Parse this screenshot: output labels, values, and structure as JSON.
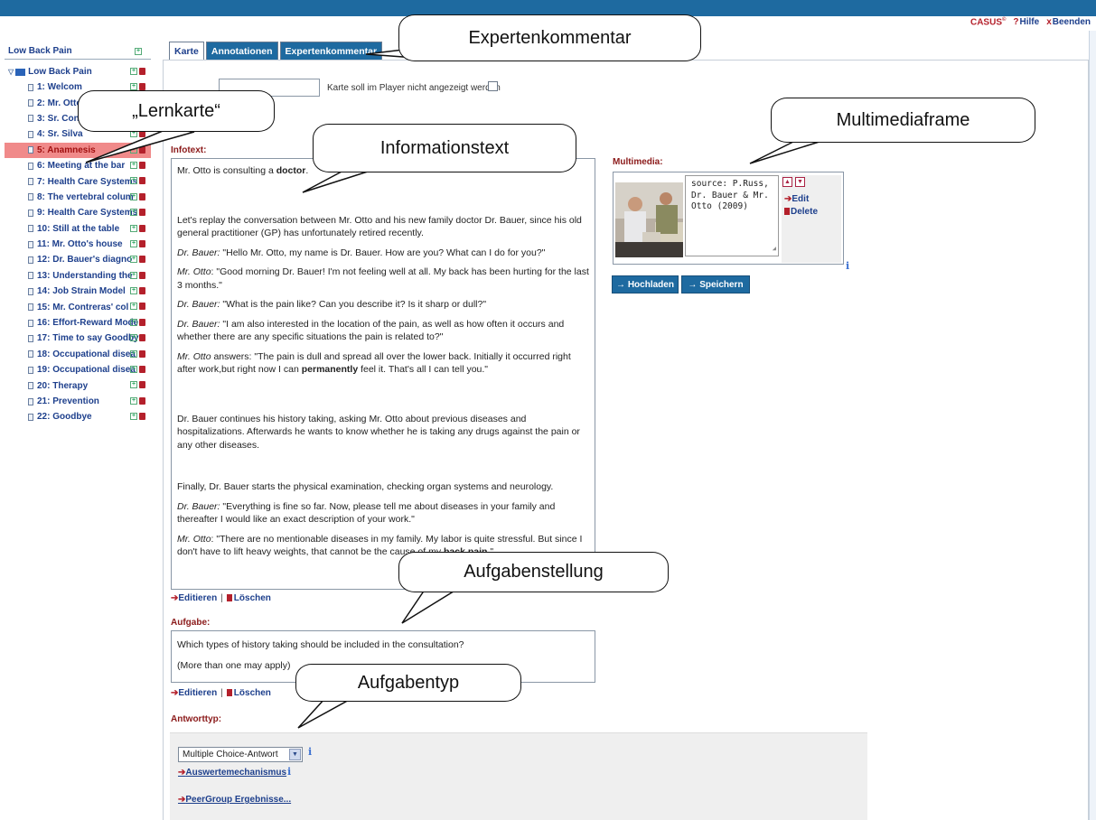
{
  "header": {
    "brand": "CASUS",
    "brand_mark": "©",
    "help_label": "Hilfe",
    "help_mark": "?",
    "exit_label": "Beenden",
    "exit_mark": "x"
  },
  "sidebar": {
    "title": "Low Back Pain",
    "root_label": "Low Back Pain",
    "items": [
      {
        "label": "1: Welcom"
      },
      {
        "label": "2: Mr. Otto"
      },
      {
        "label": "3: Sr. Cont"
      },
      {
        "label": "4: Sr. Silva"
      },
      {
        "label": "5: Anamnesis",
        "active": true
      },
      {
        "label": "6: Meeting at the bar"
      },
      {
        "label": "7: Health Care Systems"
      },
      {
        "label": "8: The vertebral colum"
      },
      {
        "label": "9: Health Care Systems"
      },
      {
        "label": "10: Still at the table"
      },
      {
        "label": "11: Mr. Otto's house"
      },
      {
        "label": "12: Dr. Bauer's diagno"
      },
      {
        "label": "13: Understanding the"
      },
      {
        "label": "14: Job Strain Model"
      },
      {
        "label": "15: Mr. Contreras' col"
      },
      {
        "label": "16: Effort-Reward Mode"
      },
      {
        "label": "17: Time to say Goodby"
      },
      {
        "label": "18: Occupational disea"
      },
      {
        "label": "19: Occupational disea"
      },
      {
        "label": "20: Therapy"
      },
      {
        "label": "21: Prevention"
      },
      {
        "label": "22: Goodbye"
      }
    ]
  },
  "tabs": [
    {
      "label": "Karte",
      "active": true
    },
    {
      "label": "Annotationen",
      "active": false
    },
    {
      "label": "Expertenkommentar",
      "active": false
    }
  ],
  "card": {
    "hide_label": "Karte soll im Player nicht angezeigt werden",
    "infotext_label": "Infotext:",
    "infotext": {
      "p1_a": "Mr. Otto is consulting a ",
      "p1_b": "doctor",
      "p1_c": ".",
      "p2": "Let's replay the conversation between Mr. Otto and his new family doctor Dr. Bauer, since his old general practitioner (GP) has unfortunately retired recently.",
      "p3_speaker": "Dr. Bauer:",
      "p3_text": " \"Hello Mr. Otto, my name is Dr. Bauer. How are you? What can I do for you?\"",
      "p4_speaker": "Mr. Otto",
      "p4_text": ": \"Good morning Dr. Bauer! I'm not feeling well at all. My back has been hurting for the last 3 months.\"",
      "p5_speaker": "Dr. Bauer:",
      "p5_text": " \"What is the pain like? Can you describe it? Is it sharp or dull?\"",
      "p6_speaker": "Dr. Bauer:",
      "p6_text": " \"I am also interested in the location of the pain, as well as how often it occurs and whether there are any specific situations the pain is related to?\"",
      "p7_speaker": "Mr. Otto",
      "p7_text_a": " answers: \"The pain is dull and spread all over the lower back. Initially it occurred right after work,but right now I can ",
      "p7_bold": "permanently",
      "p7_text_b": " feel it. That's all I can tell you.\"",
      "p8": "Dr. Bauer continues his history taking, asking Mr. Otto about previous diseases and hospitalizations. Afterwards he wants to know whether he is taking any drugs against the pain or any other diseases.",
      "p9": "Finally, Dr. Bauer starts the physical examination, checking organ systems and neurology.",
      "p10_speaker": "Dr. Bauer:",
      "p10_text": " \"Everything is fine so far. Now, please tell me about diseases in your family and thereafter I would like an exact description of your work.\"",
      "p11_speaker": "Mr. Otto",
      "p11_text_a": ": \"There are no mentionable diseases in my family. My labor is quite stressful. But since I don't have to lift heavy weights, that cannot be the cause of my ",
      "p11_bold": "back pain",
      "p11_text_b": ".\""
    },
    "edit_label": "Editieren",
    "delete_label": "Löschen",
    "task_label": "Aufgabe:",
    "task_line1": "Which types of history taking should be included in the consultation?",
    "task_line2": "(More than one may apply)",
    "answer_type_label": "Antworttyp:",
    "answer_type_value": "Multiple Choice-Antwort",
    "evaluation_link": "Auswertemechanismus",
    "peergroup_link": "PeerGroup Ergebnisse..."
  },
  "multimedia": {
    "label": "Multimedia:",
    "caption": "source: P.Russ,\nDr. Bauer & Mr.\nOtto (2009)",
    "edit_label": "Edit",
    "delete_label": "Delete",
    "upload_label": "Hochladen",
    "save_label": "Speichern"
  },
  "annotations": {
    "expertenkommentar": "Expertenkommentar",
    "lernkarte": "„Lernkarte“",
    "informationstext": "Informationstext",
    "multimediaframe": "Multimediaframe",
    "aufgabenstellung": "Aufgabenstellung",
    "aufgabentyp": "Aufgabentyp"
  },
  "colors": {
    "header_blue": "#1e6aa0",
    "active_row": "#f08a8a",
    "label_red": "#8b1a1a",
    "link_blue": "#1d3f8c"
  }
}
